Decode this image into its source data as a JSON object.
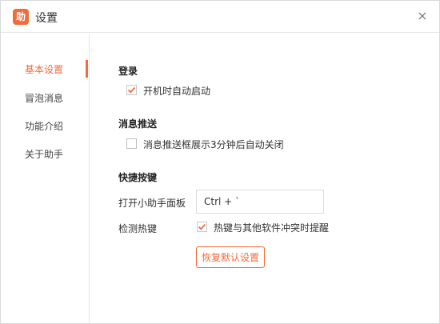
{
  "window": {
    "title": "设置",
    "logo_text": "助",
    "accent_color": "#f26b3a"
  },
  "sidebar": {
    "items": [
      {
        "label": "基本设置",
        "active": true
      },
      {
        "label": "冒泡消息",
        "active": false
      },
      {
        "label": "功能介绍",
        "active": false
      },
      {
        "label": "关于助手",
        "active": false
      }
    ]
  },
  "login": {
    "title": "登录",
    "autostart_label": "开机时自动启动",
    "autostart_checked": true
  },
  "push": {
    "title": "消息推送",
    "autoclose_label": "消息推送框展示3分钟后自动关闭",
    "autoclose_checked": false
  },
  "hotkeys": {
    "title": "快捷按键",
    "open_panel_label": "打开小助手面板",
    "open_panel_value": "Ctrl + `",
    "detect_label": "检测热键",
    "conflict_label": "热键与其他软件冲突时提醒",
    "conflict_checked": true,
    "reset_label": "恢复默认设置"
  },
  "icons": {
    "close": "close-icon",
    "checkmark": "checkmark-icon"
  }
}
